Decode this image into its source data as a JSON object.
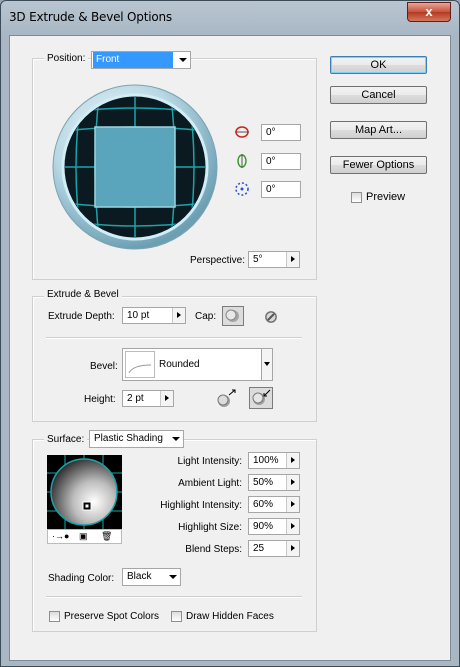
{
  "window": {
    "title": "3D Extrude & Bevel Options",
    "close_symbol": "x"
  },
  "buttons": {
    "ok": "OK",
    "cancel": "Cancel",
    "map_art": "Map Art...",
    "fewer_options": "Fewer Options"
  },
  "preview": {
    "label": "Preview",
    "checked": false
  },
  "position": {
    "label": "Position:",
    "value": "Front",
    "rotation_x": "0°",
    "rotation_y": "0°",
    "rotation_z": "0°",
    "perspective_label": "Perspective:",
    "perspective_value": "5°"
  },
  "extrude": {
    "group_label": "Extrude & Bevel",
    "depth_label": "Extrude Depth:",
    "depth_value": "10 pt",
    "cap_label": "Cap:",
    "bevel_label": "Bevel:",
    "bevel_value": "Rounded",
    "height_label": "Height:",
    "height_value": "2 pt"
  },
  "surface": {
    "label": "Surface:",
    "value": "Plastic Shading",
    "light_intensity_label": "Light Intensity:",
    "light_intensity_value": "100%",
    "ambient_light_label": "Ambient Light:",
    "ambient_light_value": "50%",
    "highlight_intensity_label": "Highlight Intensity:",
    "highlight_intensity_value": "60%",
    "highlight_size_label": "Highlight Size:",
    "highlight_size_value": "90%",
    "blend_steps_label": "Blend Steps:",
    "blend_steps_value": "25",
    "shading_color_label": "Shading Color:",
    "shading_color_value": "Black",
    "preserve_spot_label": "Preserve Spot Colors",
    "draw_hidden_label": "Draw Hidden Faces"
  },
  "colors": {
    "accent": "#3399ff",
    "cube_face": "#5aa5bc",
    "grid": "#1aa3a8"
  }
}
